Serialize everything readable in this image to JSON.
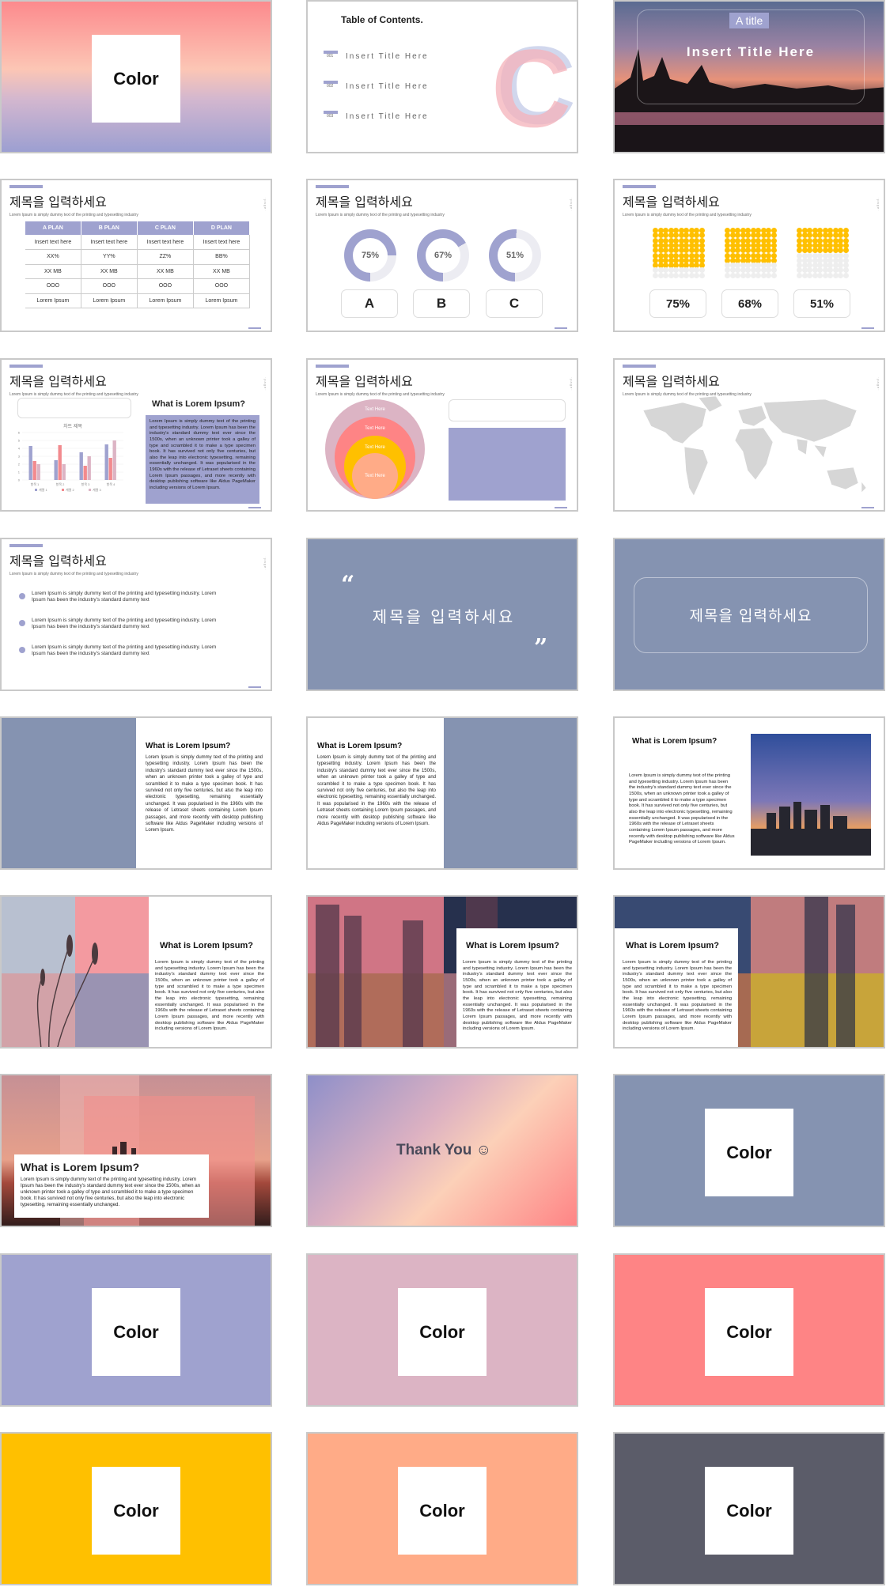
{
  "color_label": "Color",
  "toc": {
    "title": "Table of Contents.",
    "items": [
      {
        "num": "001",
        "label": "Insert Title Here"
      },
      {
        "num": "002",
        "label": "Insert Title Here"
      },
      {
        "num": "003",
        "label": "Insert Title Here"
      }
    ],
    "big_letter": "C"
  },
  "cover": {
    "badge": "A title",
    "title": "Insert Title Here"
  },
  "common": {
    "korean_title": "제목을 입력하세요",
    "subtitle": "Lorem Ipsum is simply dummy text of the printing and typesetting industry",
    "lorem_heading": "What is Lorem Ipsum?",
    "lorem_long": "Lorem Ipsum is simply dummy text of the printing and typesetting industry. Lorem Ipsum has been the industry's standard dummy text ever since the 1500s, when an unknown printer took a galley of type and scrambled it to make a type specimen book. It has survived not only five centuries, but also the leap into electronic typesetting, remaining essentially unchanged. It was popularised in the 1960s with the release of Letraset sheets containing Lorem Ipsum passages, and more recently with desktop publishing software like Aldus PageMaker including versions of Lorem Ipsum.",
    "lorem_short": "Lorem Ipsum is simply dummy text of the printing and typesetting industry. Lorem Ipsum has been the industry's standard dummy text ever since the 1500s, when an unknown printer took a galley of type and scrambled it to make a type specimen book. It has survived not only five centuries, but also the leap into electronic typesetting, remaining essentially unchanged.",
    "bullet_text": "Lorem Ipsum is simply dummy text of the printing and typesetting industry. Lorem Ipsum has been the industry's standard dummy text"
  },
  "table": {
    "headers": [
      "A PLAN",
      "B PLAN",
      "C PLAN",
      "D PLAN"
    ],
    "rows": [
      [
        "Insert text here",
        "Insert text here",
        "Insert text here",
        "Insert text here"
      ],
      [
        "XX%",
        "YY%",
        "ZZ%",
        "BB%"
      ],
      [
        "XX MB",
        "XX MB",
        "XX MB",
        "XX MB"
      ],
      [
        "OOO",
        "OOO",
        "OOO",
        "OOO"
      ],
      [
        "Lorem Ipsum",
        "Lorem Ipsum",
        "Lorem Ipsum",
        "Lorem Ipsum"
      ]
    ]
  },
  "donuts": [
    {
      "label": "A",
      "percent": 75,
      "text": "75%"
    },
    {
      "label": "B",
      "percent": 67,
      "text": "67%"
    },
    {
      "label": "C",
      "percent": 51,
      "text": "51%"
    }
  ],
  "dot_charts": [
    {
      "percent": 75,
      "text": "75%"
    },
    {
      "percent": 68,
      "text": "68%"
    },
    {
      "percent": 51,
      "text": "51%"
    }
  ],
  "chart_data": {
    "type": "bar",
    "title": "차트 제목",
    "categories": [
      "항목 1",
      "항목 2",
      "항목 3",
      "항목 4"
    ],
    "ylim": [
      0,
      6
    ],
    "yticks": [
      0,
      1,
      2,
      3,
      4,
      5,
      6
    ],
    "series": [
      {
        "name": "계열 1",
        "values": [
          4.3,
          2.5,
          3.5,
          4.5
        ],
        "color": "#9fa2cf"
      },
      {
        "name": "계열 2",
        "values": [
          2.4,
          4.4,
          1.8,
          2.8
        ],
        "color": "#f28a8e"
      },
      {
        "name": "계열 3",
        "values": [
          2.0,
          2.0,
          3.0,
          5.0
        ],
        "color": "#dcb4c4"
      }
    ]
  },
  "concentric_labels": [
    "Text Here",
    "Text Here",
    "Text Here",
    "Text Here"
  ],
  "thank_you": "Thank You ☺",
  "colors": {
    "accent": "#9fa2cf",
    "steel": "#8593b1",
    "pink": "#dcb4c4",
    "coral": "#fe8485",
    "yellow": "#ffc000",
    "peach": "#ffab87",
    "slate": "#5b5c69"
  }
}
